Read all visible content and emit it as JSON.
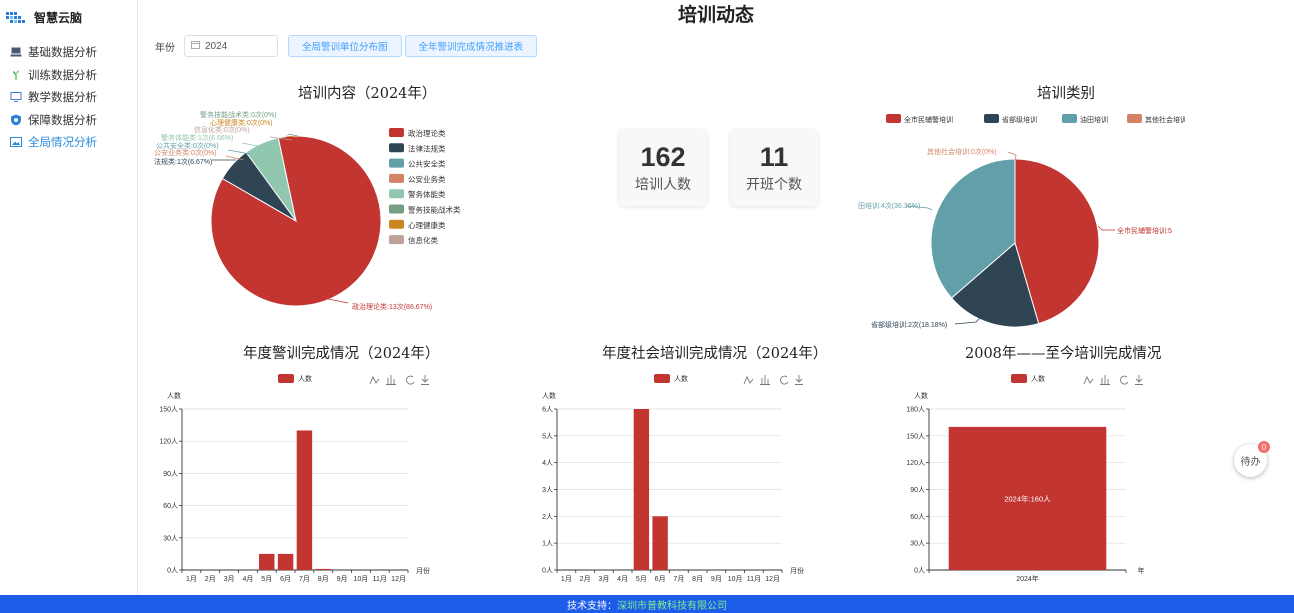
{
  "app": {
    "name": "智慧云脑"
  },
  "sidebar": {
    "items": [
      {
        "label": "基础数据分析",
        "icon": "computer-icon"
      },
      {
        "label": "训练数据分析",
        "icon": "sprout-icon"
      },
      {
        "label": "教学数据分析",
        "icon": "monitor-icon"
      },
      {
        "label": "保障数据分析",
        "icon": "shield-icon"
      },
      {
        "label": "全局情况分析",
        "icon": "image-icon",
        "active": true
      }
    ]
  },
  "page": {
    "title": "培训动态"
  },
  "toolbar": {
    "year_label": "年份",
    "year_value": "2024",
    "btn_distribution": "全局警训单位分布图",
    "btn_progress": "全年警训完成情况推进表"
  },
  "stats": {
    "trainees": {
      "value": "162",
      "label": "培训人数"
    },
    "classes": {
      "value": "11",
      "label": "开班个数"
    }
  },
  "charts": {
    "content": {
      "title": "培训内容（2024年）",
      "legend": [
        "政治理论类",
        "法律法规类",
        "公共安全类",
        "公安业务类",
        "警务体能类",
        "警务技能战术类",
        "心理健康类",
        "信息化类"
      ],
      "colors": [
        "#c23531",
        "#2f4554",
        "#61a0a8",
        "#d48265",
        "#91c7ae",
        "#749f83",
        "#ca8622",
        "#bda29a"
      ],
      "callouts": [
        {
          "text": "警务技能战术类:0次(0%)",
          "color": "#749f83"
        },
        {
          "text": "心理健康类:0次(0%)",
          "color": "#ca8622"
        },
        {
          "text": "信息化类:0次(0%)",
          "color": "#bda29a"
        },
        {
          "text": "警务体能类:1次(6.66%)",
          "color": "#91c7ae"
        },
        {
          "text": "公共安全类:0次(0%)",
          "color": "#61a0a8"
        },
        {
          "text": "公安业务类:0次(0%)",
          "color": "#d48265"
        },
        {
          "text": "法规类:1次(6.67%)",
          "color": "#2f4554"
        },
        {
          "text": "政治理论类:13次(86.67%)",
          "color": "#c23531"
        }
      ]
    },
    "category": {
      "title": "培训类别",
      "legend": [
        "全市民辅警培训",
        "省部级培训",
        "油田培训",
        "其他社会培训"
      ],
      "colors": [
        "#c23531",
        "#2f4554",
        "#61a0a8",
        "#d48265"
      ],
      "callouts": [
        {
          "text": "其他社会培训:0次(0%)",
          "color": "#d48265"
        },
        {
          "text": "田培训:4次(36.36%)",
          "color": "#61a0a8"
        },
        {
          "text": "全市民辅警培训:5",
          "color": "#c23531"
        },
        {
          "text": "省部级培训:2次(18.18%)",
          "color": "#2f4554"
        }
      ]
    },
    "police": {
      "title": "年度警训完成情况（2024年）"
    },
    "social": {
      "title": "年度社会培训完成情况（2024年）"
    },
    "history": {
      "title": "2008年——至今培训完成情况"
    }
  },
  "chart_data": [
    {
      "type": "pie",
      "title": "培训内容（2024年）",
      "categories": [
        "政治理论类",
        "法律法规类",
        "公共安全类",
        "公安业务类",
        "警务体能类",
        "警务技能战术类",
        "心理健康类",
        "信息化类"
      ],
      "values": [
        13,
        1,
        0,
        0,
        1,
        0,
        0,
        0
      ],
      "legend": "right"
    },
    {
      "type": "pie",
      "title": "培训类别",
      "categories": [
        "全市民辅警培训",
        "省部级培训",
        "油田培训",
        "其他社会培训"
      ],
      "values": [
        5,
        2,
        4,
        0
      ],
      "legend": "top"
    },
    {
      "type": "bar",
      "title": "年度警训完成情况（2024年）",
      "series": [
        {
          "name": "人数",
          "values": [
            0,
            0,
            0,
            0,
            15,
            15,
            130,
            1,
            0,
            0,
            0,
            0
          ]
        }
      ],
      "categories": [
        "1月",
        "2月",
        "3月",
        "4月",
        "5月",
        "6月",
        "7月",
        "8月",
        "9月",
        "10月",
        "11月",
        "12月"
      ],
      "ylabel": "人数",
      "xlabel": "月份",
      "yticks": [
        "0人",
        "30人",
        "60人",
        "90人",
        "120人",
        "150人"
      ],
      "ylim": [
        0,
        150
      ],
      "grid": true,
      "legend": "top"
    },
    {
      "type": "bar",
      "title": "年度社会培训完成情况（2024年）",
      "series": [
        {
          "name": "人数",
          "values": [
            0,
            0,
            0,
            0,
            6,
            2,
            0,
            0,
            0,
            0,
            0,
            0
          ]
        }
      ],
      "categories": [
        "1月",
        "2月",
        "3月",
        "4月",
        "5月",
        "6月",
        "7月",
        "8月",
        "9月",
        "10月",
        "11月",
        "12月"
      ],
      "ylabel": "人数",
      "xlabel": "月份",
      "yticks": [
        "0人",
        "1人",
        "2人",
        "3人",
        "4人",
        "5人",
        "6人"
      ],
      "ylim": [
        0,
        6
      ],
      "grid": true,
      "legend": "top"
    },
    {
      "type": "bar",
      "title": "2008年——至今培训完成情况",
      "series": [
        {
          "name": "人数",
          "values": [
            160
          ]
        }
      ],
      "categories": [
        "2024年"
      ],
      "data_labels": [
        "2024年:160人"
      ],
      "ylabel": "人数",
      "xlabel": "年",
      "yticks": [
        "0人",
        "30人",
        "60人",
        "90人",
        "120人",
        "150人",
        "180人"
      ],
      "ylim": [
        0,
        180
      ],
      "grid": true,
      "legend": "top"
    }
  ],
  "float_button": {
    "label": "待办",
    "badge": "0"
  },
  "footer": {
    "prefix": "技术支持：",
    "company": "深圳市普教科技有限公司"
  }
}
